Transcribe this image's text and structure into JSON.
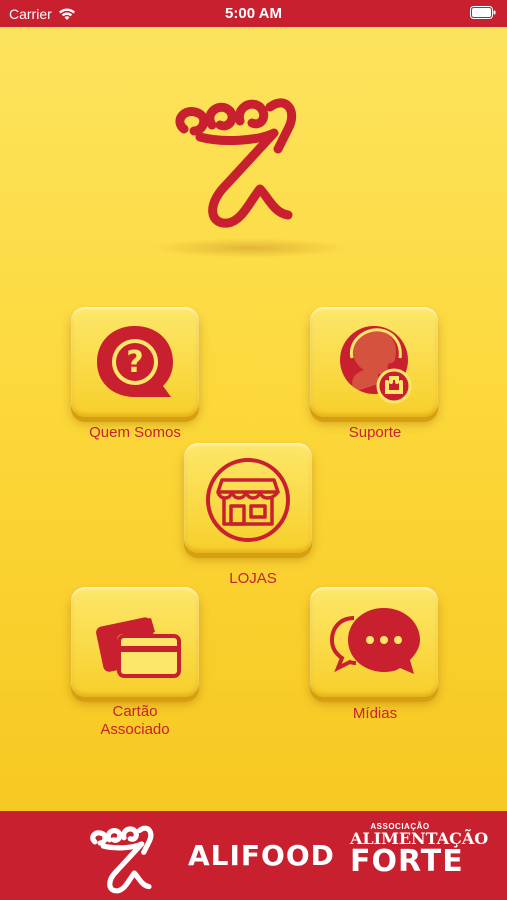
{
  "status_bar": {
    "carrier": "Carrier",
    "time": "5:00 AM",
    "icons": [
      "wifi-icon",
      "battery-icon"
    ]
  },
  "menu": [
    {
      "label": "Quem Somos",
      "icon": "question-bubble-icon"
    },
    {
      "label": "Suporte",
      "icon": "support-agent-icon"
    },
    {
      "label": "LOJAS",
      "icon": "store-icon"
    },
    {
      "label": "Cartão\nAssociado",
      "icon": "cards-icon"
    },
    {
      "label": "Mídias",
      "icon": "chat-bubbles-icon"
    }
  ],
  "footer": {
    "brand": "ALIFOOD",
    "assoc_line1": "ASSOCIAÇÃO",
    "assoc_line2": "ALIMENTAÇÃO",
    "assoc_line3": "FORTE"
  },
  "colors": {
    "primary_red": "#c8202f",
    "background_yellow": "#fcd83a"
  }
}
